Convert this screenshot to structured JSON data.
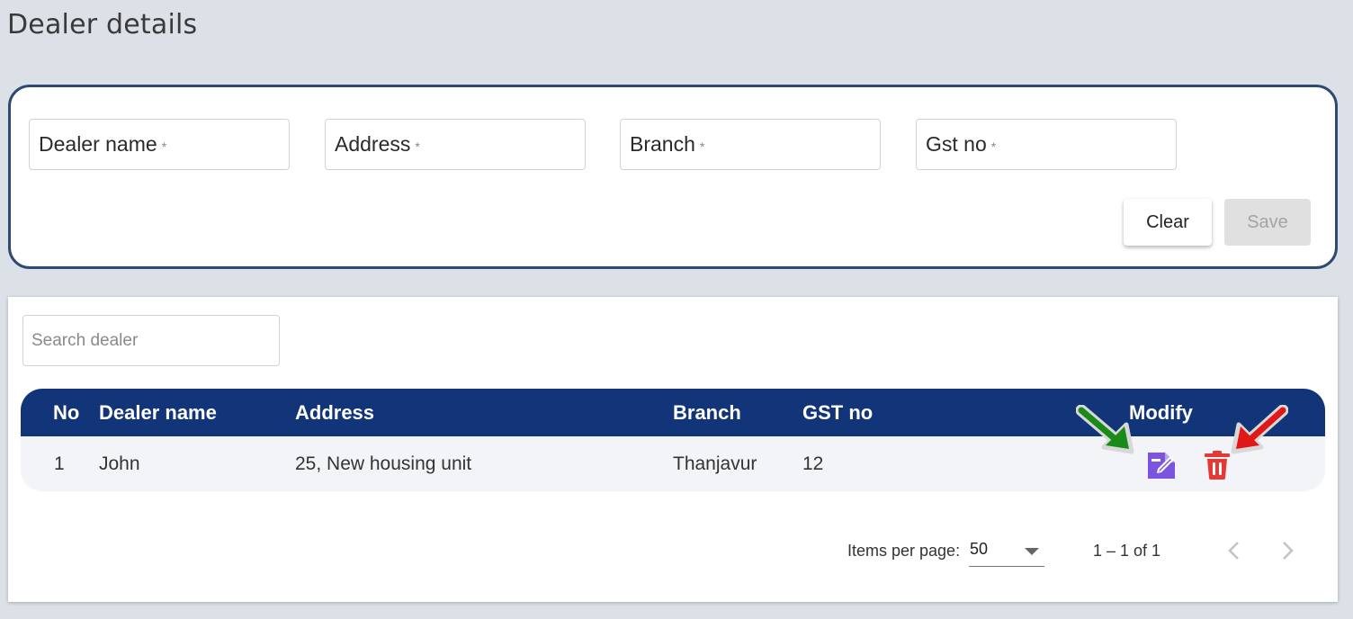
{
  "page": {
    "title": "Dealer details"
  },
  "form": {
    "fields": [
      {
        "label": "Dealer name",
        "required": "*"
      },
      {
        "label": "Address",
        "required": "*"
      },
      {
        "label": "Branch",
        "required": "*"
      },
      {
        "label": "Gst no",
        "required": "*"
      }
    ],
    "clear_label": "Clear",
    "save_label": "Save"
  },
  "search": {
    "placeholder": "Search dealer",
    "value": ""
  },
  "table": {
    "columns": [
      "No",
      "Dealer name",
      "Address",
      "Branch",
      "GST no",
      "Modify"
    ],
    "rows": [
      {
        "no": "1",
        "dealer_name": "John",
        "address": "25, New housing unit",
        "branch": "Thanjavur",
        "gst_no": "12"
      }
    ],
    "edit_icon": "edit-note-icon",
    "delete_icon": "trash-icon"
  },
  "paginator": {
    "items_per_page_label": "Items per page:",
    "items_per_page": "50",
    "range_label": "1 – 1 of 1"
  },
  "colors": {
    "header": "#12357a",
    "form_border": "#2e4a70",
    "edit_icon": "#7b55e0",
    "delete_icon": "#e53935",
    "arrow_green": "#1a8a1a",
    "arrow_red": "#e01818"
  }
}
